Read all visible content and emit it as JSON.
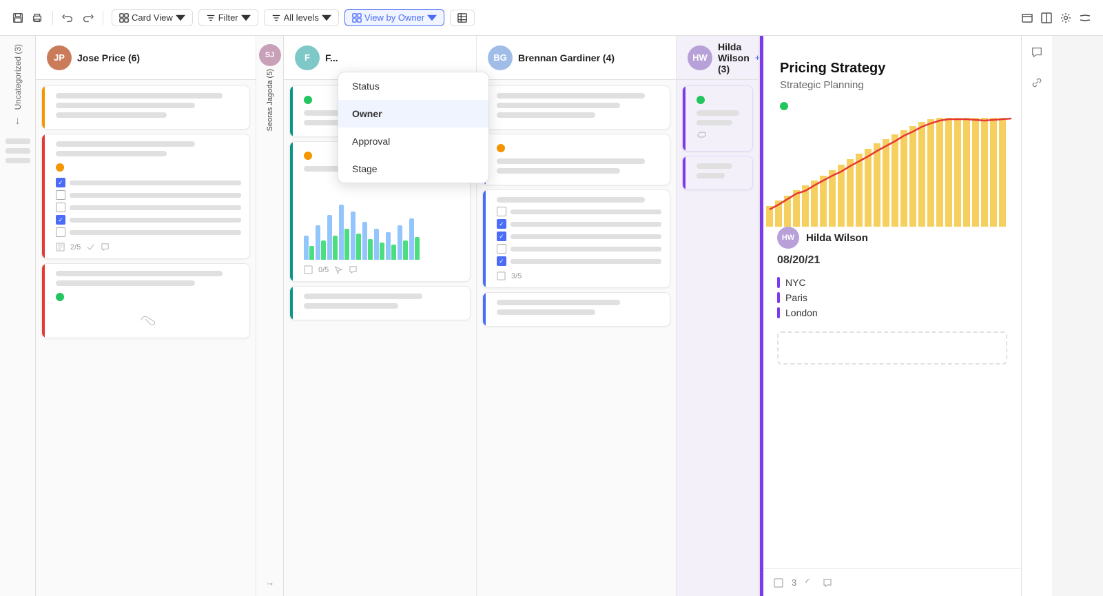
{
  "toolbar": {
    "save_label": "💾",
    "print_label": "🖨",
    "undo_label": "↩",
    "redo_label": "↪",
    "view_mode_label": "Card View",
    "filter_label": "Filter",
    "levels_label": "All levels",
    "view_by_label": "View by Owner",
    "grid_label": "⊞",
    "collapse_label": "⊟",
    "expand_label": "⊞",
    "settings_label": "⚙",
    "close_label": "∧"
  },
  "dropdown": {
    "items": [
      {
        "id": "status",
        "label": "Status",
        "selected": false
      },
      {
        "id": "owner",
        "label": "Owner",
        "selected": true
      },
      {
        "id": "approval",
        "label": "Approval",
        "selected": false
      },
      {
        "id": "stage",
        "label": "Stage",
        "selected": false
      }
    ]
  },
  "uncategorized": {
    "label": "Uncategorized (3)",
    "arrow": "↓"
  },
  "columns": [
    {
      "id": "jose",
      "owner_name": "Jose Price (6)",
      "avatar_color": "#c97b5a",
      "avatar_initials": "JP",
      "cards": [
        {
          "accent": "orange",
          "lines": [
            "long",
            "medium",
            "short"
          ],
          "dot": null
        },
        {
          "accent": "red",
          "lines": [
            "medium",
            "short"
          ],
          "dot": "yellow",
          "checkboxes": [
            true,
            false,
            false,
            true,
            false
          ],
          "footer": "2/5"
        },
        {
          "accent": "red",
          "lines": [
            "long",
            "medium"
          ],
          "dot": "green"
        }
      ]
    },
    {
      "id": "seoras",
      "owner_name": "Seoras Jagoda (5)",
      "avatar_color": "#e0b0c8",
      "avatar_initials": "SJ",
      "collapsed": true
    },
    {
      "id": "feya",
      "owner_name": "F...",
      "avatar_color": "#7ec8c8",
      "avatar_initials": "F",
      "cards": [
        {
          "accent": "teal",
          "dot": "green",
          "lines": [
            "long",
            "medium"
          ]
        },
        {
          "accent": "teal",
          "dot": "yellow",
          "lines": [
            "long",
            "medium"
          ],
          "has_chart": true,
          "footer": "0/5"
        },
        {
          "accent": "teal",
          "lines": [
            "medium",
            "short"
          ]
        }
      ]
    },
    {
      "id": "brennan",
      "owner_name": "Brennan Gardiner (4)",
      "avatar_color": "#a0bde8",
      "avatar_initials": "BG",
      "cards": [
        {
          "accent": "blue",
          "dot": null,
          "lines": [
            "long",
            "medium",
            "short"
          ]
        },
        {
          "accent": "blue",
          "dot": "yellow",
          "lines": [
            "long",
            "medium"
          ]
        },
        {
          "accent": "blue",
          "checkboxes": [
            false,
            true,
            true,
            false,
            true
          ],
          "lines": [
            "long"
          ],
          "footer": "3/5"
        },
        {
          "accent": "blue",
          "lines": [
            "medium",
            "short"
          ]
        }
      ]
    },
    {
      "id": "hilda",
      "owner_name": "Hilda Wilson (3)",
      "avatar_color": "#b8a0d8",
      "avatar_initials": "HW",
      "add_label": "+ Add",
      "cards": [
        {
          "accent": "purple",
          "dot": "green",
          "lines": [
            "long",
            "medium"
          ],
          "has_attachment": true
        },
        {
          "accent": "purple",
          "lines": [
            "medium",
            "short"
          ]
        }
      ]
    }
  ],
  "detail": {
    "title": "Pricing Strategy",
    "subtitle": "Strategic Planning",
    "dot_color": "green",
    "owner_name": "Hilda Wilson",
    "owner_avatar_color": "#b8a0d8",
    "owner_initials": "HW",
    "date": "08/20/21",
    "locations": [
      "NYC",
      "Paris",
      "London"
    ],
    "footer_count": "3",
    "chart": {
      "bars": [
        3,
        4,
        5,
        6,
        7,
        8,
        9,
        10,
        11,
        12,
        13,
        14,
        15,
        14,
        13,
        12,
        14,
        16,
        18,
        20,
        22,
        24,
        26,
        28,
        30
      ],
      "line": [
        5,
        6,
        5,
        7,
        8,
        7,
        9,
        10,
        9,
        11,
        12,
        13,
        14,
        15,
        16,
        18,
        19,
        21,
        23,
        25,
        27,
        29,
        31,
        33,
        35
      ]
    }
  },
  "side_panel": {
    "chat_icon": "💬",
    "link_icon": "🔗"
  }
}
